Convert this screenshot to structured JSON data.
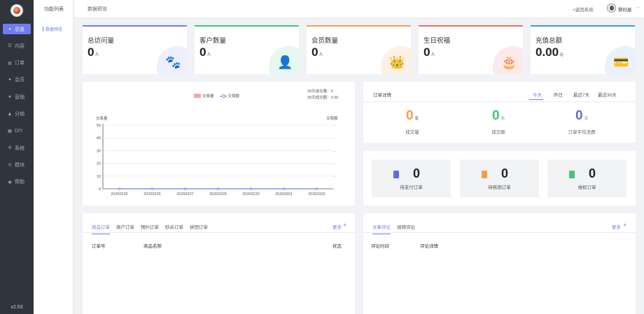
{
  "sidebar": {
    "version": "v2.53",
    "items": [
      {
        "label": "总览",
        "icon": "dashboard-icon",
        "glyph": "◕",
        "active": true
      },
      {
        "label": "内容",
        "icon": "list-icon",
        "glyph": "☰"
      },
      {
        "label": "订单",
        "icon": "document-icon",
        "glyph": "▤"
      },
      {
        "label": "会员",
        "icon": "user-icon",
        "glyph": "●"
      },
      {
        "label": "营销",
        "icon": "star-icon",
        "glyph": "★"
      },
      {
        "label": "分销",
        "icon": "group-icon",
        "glyph": "♟"
      },
      {
        "label": "DIY",
        "icon": "grid-icon",
        "glyph": "▦"
      },
      {
        "label": "系统",
        "icon": "gear-icon",
        "glyph": "✲"
      },
      {
        "label": "模块",
        "icon": "module-icon",
        "glyph": "◎"
      },
      {
        "label": "帮助",
        "icon": "help-icon",
        "glyph": "◉"
      }
    ]
  },
  "subpanel": {
    "title": "功能列表",
    "item": "数据预览"
  },
  "topbar": {
    "breadcrumb": "数据预览",
    "back": "<返回系统",
    "user": "黎码屋",
    "chevron": "⌵"
  },
  "stats": [
    {
      "label": "总访问量",
      "value": "0",
      "unit": "人",
      "color": "#6f7cf3",
      "icon": "paw-icon",
      "glyph": "🐾",
      "bg": "#edeffd"
    },
    {
      "label": "客户数量",
      "value": "0",
      "unit": "人",
      "color": "#43c67a",
      "icon": "person-icon",
      "glyph": "👤",
      "bg": "#e6f7ed"
    },
    {
      "label": "会员数量",
      "value": "0",
      "unit": "人",
      "color": "#f0a04b",
      "icon": "crown-icon",
      "glyph": "👑",
      "bg": "#fdf1e4"
    },
    {
      "label": "生日祝福",
      "value": "0",
      "unit": "人",
      "color": "#ef6b6b",
      "icon": "cake-icon",
      "glyph": "🎂",
      "bg": "#fde9e9"
    },
    {
      "label": "充值总额",
      "value": "0.00",
      "unit": "元",
      "color": "#4a90e2",
      "icon": "card-icon",
      "glyph": "💳",
      "bg": "#e8f1fc"
    }
  ],
  "chart": {
    "legend_bar": "交易量",
    "legend_line": "交易额",
    "note1": "30天成交量：0",
    "note2": "30天成交额：0.00"
  },
  "chart_data": {
    "type": "bar",
    "categories": [
      "20200225",
      "20200226",
      "20200227",
      "20200228",
      "20200229",
      "20200301",
      "20200302"
    ],
    "series": [
      {
        "name": "交易量",
        "type": "bar",
        "values": [
          0,
          0,
          0,
          0,
          0,
          0,
          0
        ],
        "color": "#f4a6a6"
      },
      {
        "name": "交易额",
        "type": "line",
        "values": [
          0,
          0,
          0,
          0,
          0,
          0,
          0
        ],
        "color": "#6f7cf3"
      }
    ],
    "ylabel": "交易量",
    "y2label": "交易额",
    "yticks": [
      0,
      10,
      20,
      30,
      40,
      50
    ],
    "ylim": [
      0,
      50
    ],
    "grid": true,
    "legend": "top-center"
  },
  "order_detail": {
    "title": "订单详情",
    "tabs": [
      "今天",
      "昨日",
      "最近7天",
      "最近30天"
    ],
    "metrics": [
      {
        "value": "0",
        "unit": "笔",
        "label": "成交量",
        "color": "#f0a04b"
      },
      {
        "value": "0",
        "unit": "元",
        "label": "成交额",
        "color": "#43c67a"
      },
      {
        "value": "0",
        "unit": "元",
        "label": "订单平均消费",
        "color": "#5b6ee1"
      }
    ]
  },
  "order_status": [
    {
      "value": "0",
      "label": "待支付订单",
      "color": "#5b6ee1",
      "icon": "pending-pay-icon"
    },
    {
      "value": "0",
      "label": "待核销订单",
      "color": "#f0a04b",
      "icon": "pending-verify-icon"
    },
    {
      "value": "0",
      "label": "维权订单",
      "color": "#43c67a",
      "icon": "rights-icon"
    }
  ],
  "orders_panel": {
    "tabs": [
      "商品订单",
      "商户订单",
      "预约订单",
      "秒杀订单",
      "拼团订单"
    ],
    "more": "更多",
    "plus": "+",
    "headers": [
      "订单号",
      "商品名称",
      "状态"
    ]
  },
  "comments_panel": {
    "tabs": [
      "文章评论",
      "视频评论"
    ],
    "more": "更多",
    "plus": "+",
    "headers": [
      "评论时间",
      "评论详情"
    ]
  }
}
